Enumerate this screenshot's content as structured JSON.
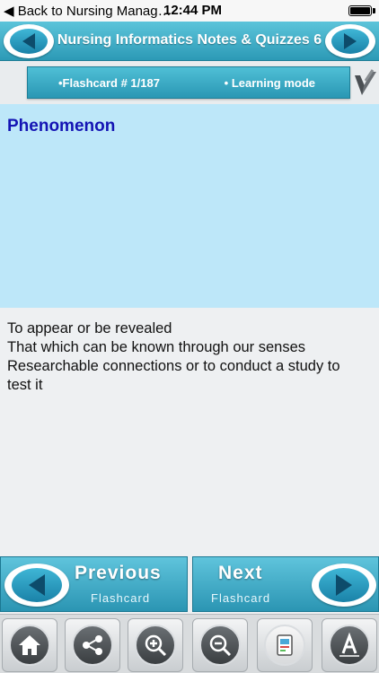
{
  "status_bar": {
    "back_label": "◀ Back to Nursing Manag…",
    "time": "12:44 PM"
  },
  "header": {
    "title": "Nursing Informatics Notes & Quizzes 6"
  },
  "subheader": {
    "flashcard_label": "•Flashcard #  1/187",
    "mode_label": "• Learning mode"
  },
  "card": {
    "term": "Phenomenon",
    "definition_lines": [
      "To appear or be revealed",
      "That which can be known through our senses",
      "Researchable connections or to conduct a study to",
      "test it"
    ]
  },
  "navigation": {
    "previous_main": "Previous",
    "previous_sub": "Flashcard",
    "next_main": "Next",
    "next_sub": "Flashcard"
  },
  "toolbar": {
    "items": [
      {
        "icon": "home-icon"
      },
      {
        "icon": "share-icon"
      },
      {
        "icon": "zoom-in-icon"
      },
      {
        "icon": "zoom-out-icon"
      },
      {
        "icon": "device-icon"
      },
      {
        "icon": "font-icon"
      }
    ]
  },
  "colors": {
    "header_teal": "#2c9ab6",
    "term_blue": "#1414b4",
    "term_bg": "#bde7f9"
  }
}
